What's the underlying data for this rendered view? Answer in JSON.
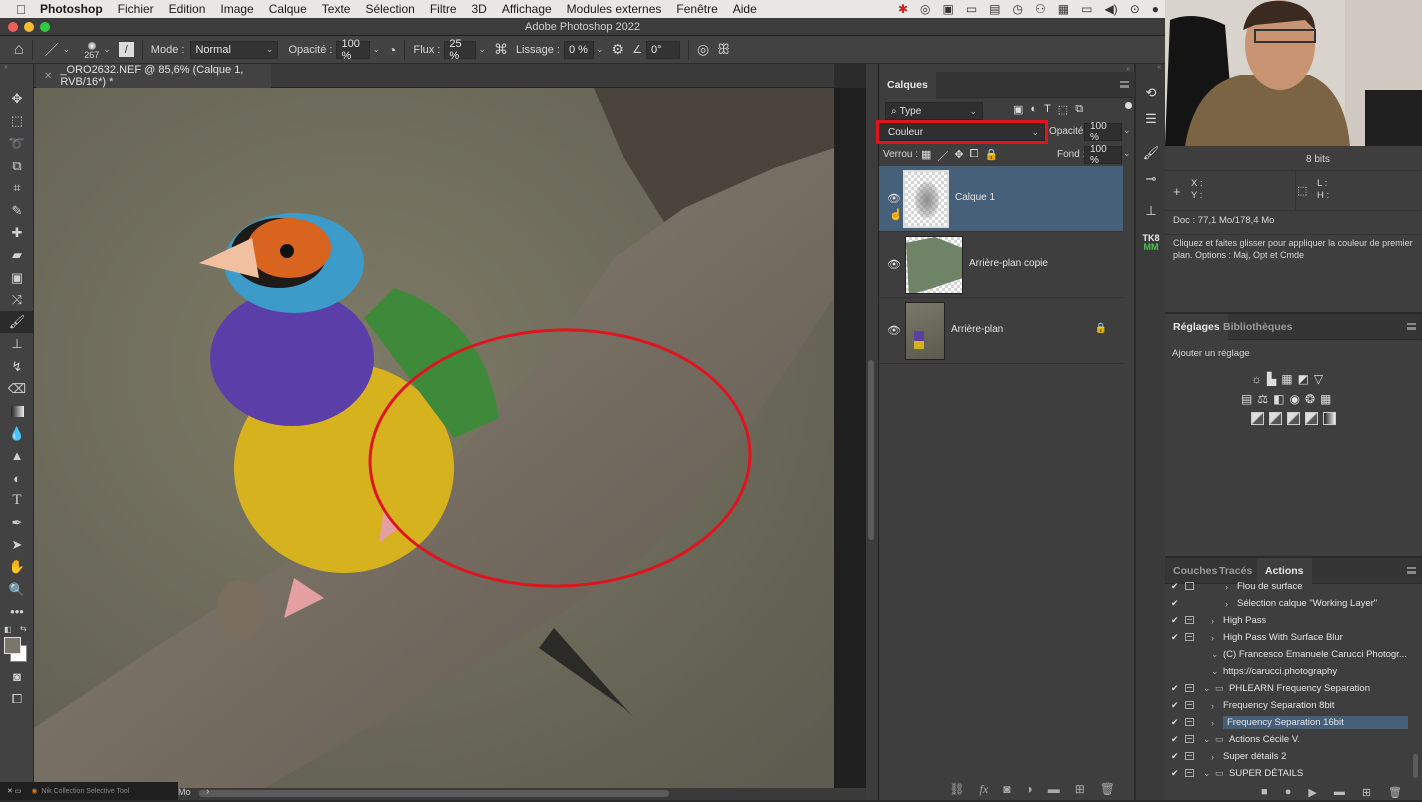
{
  "menubar": {
    "apple_icon": "apple-icon",
    "items": [
      "Photoshop",
      "Fichier",
      "Edition",
      "Image",
      "Calque",
      "Texte",
      "Sélection",
      "Filtre",
      "3D",
      "Affichage",
      "Modules externes",
      "Fenêtre",
      "Aide"
    ],
    "tray_icons": [
      "dropbox-icon",
      "creative-cloud-icon",
      "camera-icon",
      "screen-icon",
      "clipboard-icon",
      "time-machine-icon",
      "binoculars-icon",
      "layout-icon",
      "display-icon",
      "volume-icon",
      "play-icon",
      "user-icon"
    ]
  },
  "window": {
    "title": "Adobe Photoshop 2022"
  },
  "options_bar": {
    "brush_size": "267",
    "mode_label": "Mode :",
    "mode_value": "Normal",
    "opacity_label": "Opacité :",
    "opacity_value": "100 %",
    "flow_label": "Flux :",
    "flow_value": "25 %",
    "smoothing_label": "Lissage :",
    "smoothing_value": "0 %",
    "angle_value": "0°"
  },
  "document": {
    "tab_title": "_ORO2632.NEF @ 85,6% (Calque 1, RVB/16*) *",
    "zoom_fragment": "Mo"
  },
  "toolbar": {
    "tools": [
      "move",
      "marquee",
      "lasso",
      "object-select",
      "crop",
      "eyedropper",
      "spot-healing",
      "healing",
      "patch",
      "content-aware-move",
      "brush",
      "clone-stamp",
      "history-brush",
      "eraser",
      "gradient",
      "blur",
      "sharpen",
      "dodge",
      "type",
      "pen",
      "path-select",
      "hand",
      "zoom",
      "more"
    ],
    "active_tool": "brush",
    "foreground_color": "#7a776a",
    "background_color": "#ffffff"
  },
  "layers_panel": {
    "tab": "Calques",
    "filter_label": "Type",
    "blend_mode": "Couleur",
    "opacity_label": "Opacité :",
    "opacity_value": "100 %",
    "lock_label": "Verrou :",
    "fill_label": "Fond :",
    "fill_value": "100 %",
    "layers": [
      {
        "name": "Calque 1",
        "selected": true,
        "visible": true,
        "locked": false
      },
      {
        "name": "Arrière-plan copie",
        "selected": false,
        "visible": true,
        "locked": false
      },
      {
        "name": "Arrière-plan",
        "selected": false,
        "visible": true,
        "locked": true
      }
    ],
    "footer_icons": [
      "link-icon",
      "fx-icon",
      "mask-icon",
      "adjustment-icon",
      "group-folder-icon",
      "new-layer-icon",
      "trash-icon"
    ]
  },
  "info_panel": {
    "bit_depth": "8 bits",
    "x_label": "X :",
    "y_label": "Y :",
    "w_label": "L :",
    "h_label": "H :",
    "doc_size": "Doc : 77,1 Mo/178,4 Mo",
    "hint": "Cliquez et faites glisser pour appliquer la couleur de premier plan. Options : Maj, Opt et Cmde"
  },
  "adjustments_panel": {
    "tabs": [
      "Réglages",
      "Bibliothèques"
    ],
    "active_tab": "Réglages",
    "add_label": "Ajouter un réglage"
  },
  "actions_panel": {
    "tabs": [
      "Couches",
      "Tracés",
      "Actions"
    ],
    "active_tab": "Actions",
    "items": [
      {
        "label": "Flou de surface",
        "checked": true,
        "dialog": "empty",
        "level": 2,
        "arrow": "›"
      },
      {
        "label": "Sélection calque \"Working Layer\"",
        "checked": true,
        "dialog": "none",
        "level": 2,
        "arrow": "›"
      },
      {
        "label": "High Pass",
        "checked": true,
        "dialog": "filled",
        "level": 1,
        "arrow": "›"
      },
      {
        "label": "High Pass With Surface Blur",
        "checked": true,
        "dialog": "filled",
        "level": 1,
        "arrow": "›"
      },
      {
        "label": "(C) Francesco Emanuele Carucci Photogr...",
        "checked": false,
        "dialog": "none",
        "level": 1,
        "arrow": "⌄"
      },
      {
        "label": "https://carucci.photography",
        "checked": false,
        "dialog": "none",
        "level": 1,
        "arrow": "⌄"
      },
      {
        "label": "PHLEARN Frequency Separation",
        "checked": true,
        "dialog": "filled",
        "level": 0,
        "arrow": "⌄",
        "folder": true
      },
      {
        "label": "Frequency Separation 8bit",
        "checked": true,
        "dialog": "filled",
        "level": 1,
        "arrow": "›"
      },
      {
        "label": "Frequency Separation 16bit",
        "checked": true,
        "dialog": "filled",
        "level": 1,
        "arrow": "›",
        "selected": true
      },
      {
        "label": "Actions Cécile V.",
        "checked": true,
        "dialog": "filled",
        "level": 0,
        "arrow": "⌄",
        "folder": true
      },
      {
        "label": "Super détails 2",
        "checked": true,
        "dialog": "filled",
        "level": 1,
        "arrow": "›"
      },
      {
        "label": "SUPER DÉTAILS",
        "checked": true,
        "dialog": "filled",
        "level": 0,
        "arrow": "⌄",
        "folder": true
      }
    ],
    "footer_icons": [
      "stop-icon",
      "record-icon",
      "play-icon",
      "new-set-icon",
      "new-action-icon",
      "trash-icon"
    ]
  },
  "nik_tool": {
    "label": "Nik Collection Selective Tool"
  },
  "annotations": {
    "highlight_color": "#e0141e"
  }
}
